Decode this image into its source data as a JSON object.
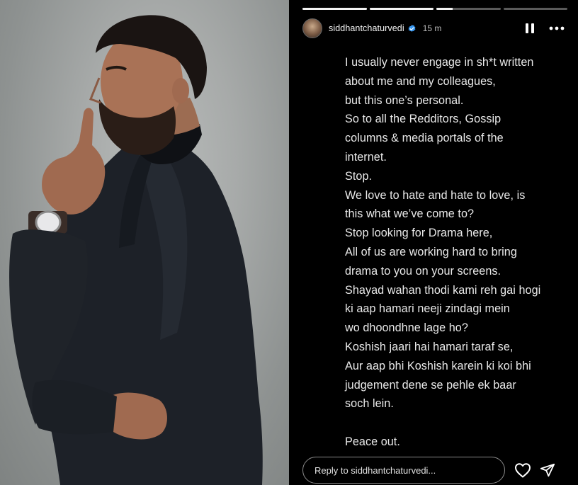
{
  "story": {
    "progress_segments": [
      1.0,
      1.0,
      0.25,
      0.0
    ],
    "username": "siddhantchaturvedi",
    "time_ago": "15 m",
    "verified": true,
    "icons": {
      "avatar": "profile-photo",
      "verified": "verified-badge-icon",
      "pause": "pause-icon",
      "more": "more-icon",
      "heart": "heart-icon",
      "send": "send-icon"
    },
    "lines": [
      "I usually never engage in sh*t written",
      "about me and my colleagues,",
      "but this one’s personal.",
      "So to all the Redditors, Gossip",
      "columns & media portals of the",
      "internet.",
      "Stop.",
      "We love to hate and hate to love, is",
      "this what we’ve come to?",
      "Stop looking for Drama here,",
      "All of us are working hard to bring",
      "drama to you on your screens.",
      "Shayad wahan thodi kami reh gai hogi",
      "ki aap hamari neeji zindagi mein",
      "wo dhoondhne lage ho?",
      "Koshish jaari hai hamari taraf se,",
      "Aur aap bhi Koshish karein ki koi bhi",
      "judgement dene se pehle ek baar",
      "soch lein.",
      "",
      "Peace out."
    ],
    "reply_placeholder": "Reply to siddhantchaturvedi..."
  },
  "colors": {
    "story_bg": "#000000",
    "text": "#e9e9e9",
    "verified_blue": "#3897f0"
  },
  "photo": {
    "subject": "man-in-dark-suit-portrait"
  }
}
